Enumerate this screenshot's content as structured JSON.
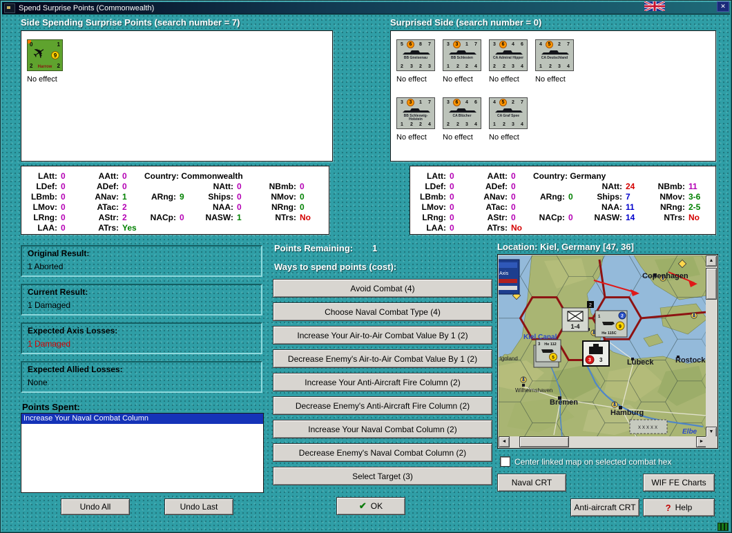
{
  "window": {
    "title": "Spend Surprise Points (Commonwealth)"
  },
  "icons": {
    "close": "✕",
    "check": "✔",
    "help": "?",
    "up": "▲",
    "down": "▼",
    "left": "◄",
    "right": "►",
    "plane": "✈"
  },
  "headers": {
    "spending": "Side Spending Surprise Points (search number = 7)",
    "surprised": "Surprised Side (search number = 0)",
    "points_remaining_label": "Points Remaining:",
    "points_remaining_value": "1",
    "ways": "Ways to spend points (cost):",
    "location": "Location: Kiel, Germany [47, 36]",
    "center_map": "Center linked map on selected combat hex",
    "points_spent": "Points Spent:"
  },
  "spending_unit": {
    "tl": "0",
    "tr": "1",
    "rating": "9",
    "bl": "2",
    "name": "Harrow",
    "br": "2",
    "effect": "No effect"
  },
  "surprised": {
    "row1": [
      {
        "t1": "5",
        "t2": "6",
        "t3": "8",
        "t4": "7",
        "name": "BB Gneisenau",
        "b1": "2",
        "b2": "3",
        "b3": "2",
        "b4": "3",
        "effect": "No effect"
      },
      {
        "t1": "3",
        "t2": "3",
        "t3": "1",
        "t4": "7",
        "name": "BB Schlesien",
        "b1": "1",
        "b2": "2",
        "b3": "2",
        "b4": "4",
        "effect": "No effect"
      },
      {
        "t1": "3",
        "t2": "6",
        "t3": "4",
        "t4": "6",
        "name": "CA Admiral Hipper",
        "b1": "2",
        "b2": "2",
        "b3": "3",
        "b4": "4",
        "effect": "No effect"
      },
      {
        "t1": "4",
        "t2": "5",
        "t3": "2",
        "t4": "7",
        "name": "CA Deutschland",
        "b1": "1",
        "b2": "2",
        "b3": "3",
        "b4": "4",
        "effect": "No effect"
      }
    ],
    "row2": [
      {
        "t1": "3",
        "t2": "3",
        "t3": "1",
        "t4": "7",
        "name": "BB Schleswig-Holstein",
        "b1": "1",
        "b2": "2",
        "b3": "2",
        "b4": "4",
        "effect": "No effect"
      },
      {
        "t1": "3",
        "t2": "6",
        "t3": "4",
        "t4": "6",
        "name": "CA Blücher",
        "b1": "2",
        "b2": "2",
        "b3": "3",
        "b4": "4",
        "effect": "No effect"
      },
      {
        "t1": "4",
        "t2": "5",
        "t3": "2",
        "t4": "7",
        "name": "CA Graf Spee",
        "b1": "1",
        "b2": "2",
        "b3": "3",
        "b4": "4",
        "effect": "No effect"
      }
    ]
  },
  "stats": {
    "commonwealth": {
      "country": "Country: Commonwealth",
      "col1": [
        {
          "l": "LAtt:",
          "v": "0",
          "c": "#b400b4"
        },
        {
          "l": "LDef:",
          "v": "0",
          "c": "#b400b4"
        },
        {
          "l": "LBmb:",
          "v": "0",
          "c": "#b400b4"
        },
        {
          "l": "LMov:",
          "v": "0",
          "c": "#b400b4"
        },
        {
          "l": "LRng:",
          "v": "0",
          "c": "#b400b4"
        },
        {
          "l": "LAA:",
          "v": "0",
          "c": "#b400b4"
        }
      ],
      "col2": [
        {
          "l": "AAtt:",
          "v": "0",
          "c": "#b400b4"
        },
        {
          "l": "ADef:",
          "v": "0",
          "c": "#b400b4"
        },
        {
          "l": "ANav:",
          "v": "1",
          "c": "#008000"
        },
        {
          "l": "ATac:",
          "v": "2",
          "c": "#b400b4"
        },
        {
          "l": "AStr:",
          "v": "2",
          "c": "#b400b4"
        },
        {
          "l": "ATrs:",
          "v": "Yes",
          "c": "#008000"
        }
      ],
      "col3": [
        {
          "l": "",
          "v": "",
          "c": ""
        },
        {
          "l": "",
          "v": "",
          "c": ""
        },
        {
          "l": "ARng:",
          "v": "9",
          "c": "#008000"
        },
        {
          "l": "",
          "v": "",
          "c": ""
        },
        {
          "l": "NACp:",
          "v": "0",
          "c": "#b400b4"
        },
        {
          "l": "",
          "v": "",
          "c": ""
        }
      ],
      "col4": [
        {
          "l": "",
          "v": "",
          "c": ""
        },
        {
          "l": "NAtt:",
          "v": "0",
          "c": "#b400b4"
        },
        {
          "l": "Ships:",
          "v": "0",
          "c": "#b400b4"
        },
        {
          "l": "NAA:",
          "v": "0",
          "c": "#b400b4"
        },
        {
          "l": "NASW:",
          "v": "1",
          "c": "#008000"
        },
        {
          "l": "",
          "v": "",
          "c": ""
        }
      ],
      "col5": [
        {
          "l": "",
          "v": "",
          "c": ""
        },
        {
          "l": "NBmb:",
          "v": "0",
          "c": "#b400b4"
        },
        {
          "l": "NMov:",
          "v": "0",
          "c": "#008000"
        },
        {
          "l": "NRng:",
          "v": "0",
          "c": "#008000"
        },
        {
          "l": "NTrs:",
          "v": "No",
          "c": "#d40000"
        },
        {
          "l": "",
          "v": "",
          "c": ""
        }
      ]
    },
    "germany": {
      "country": "Country: Germany",
      "col1": [
        {
          "l": "LAtt:",
          "v": "0",
          "c": "#b400b4"
        },
        {
          "l": "LDef:",
          "v": "0",
          "c": "#b400b4"
        },
        {
          "l": "LBmb:",
          "v": "0",
          "c": "#b400b4"
        },
        {
          "l": "LMov:",
          "v": "0",
          "c": "#b400b4"
        },
        {
          "l": "LRng:",
          "v": "0",
          "c": "#b400b4"
        },
        {
          "l": "LAA:",
          "v": "0",
          "c": "#b400b4"
        }
      ],
      "col2": [
        {
          "l": "AAtt:",
          "v": "0",
          "c": "#b400b4"
        },
        {
          "l": "ADef:",
          "v": "0",
          "c": "#b400b4"
        },
        {
          "l": "ANav:",
          "v": "0",
          "c": "#b400b4"
        },
        {
          "l": "ATac:",
          "v": "0",
          "c": "#b400b4"
        },
        {
          "l": "AStr:",
          "v": "0",
          "c": "#b400b4"
        },
        {
          "l": "ATrs:",
          "v": "No",
          "c": "#d40000"
        }
      ],
      "col3": [
        {
          "l": "",
          "v": "",
          "c": ""
        },
        {
          "l": "",
          "v": "",
          "c": ""
        },
        {
          "l": "ARng:",
          "v": "0",
          "c": "#008000"
        },
        {
          "l": "",
          "v": "",
          "c": ""
        },
        {
          "l": "NACp:",
          "v": "0",
          "c": "#b400b4"
        },
        {
          "l": "",
          "v": "",
          "c": ""
        }
      ],
      "col4": [
        {
          "l": "",
          "v": "",
          "c": ""
        },
        {
          "l": "NAtt:",
          "v": "24",
          "c": "#d40000"
        },
        {
          "l": "Ships:",
          "v": "7",
          "c": "#0000cc"
        },
        {
          "l": "NAA:",
          "v": "11",
          "c": "#0000cc"
        },
        {
          "l": "NASW:",
          "v": "14",
          "c": "#0000cc"
        },
        {
          "l": "",
          "v": "",
          "c": ""
        }
      ],
      "col5": [
        {
          "l": "",
          "v": "",
          "c": ""
        },
        {
          "l": "NBmb:",
          "v": "11",
          "c": "#b400b4"
        },
        {
          "l": "NMov:",
          "v": "3-6",
          "c": "#008000"
        },
        {
          "l": "NRng:",
          "v": "2-5",
          "c": "#008000"
        },
        {
          "l": "NTrs:",
          "v": "No",
          "c": "#d40000"
        },
        {
          "l": "",
          "v": "",
          "c": ""
        }
      ]
    }
  },
  "results": [
    {
      "title": "Original Result:",
      "value": "1 Aborted",
      "color": "#000000"
    },
    {
      "title": "Current Result:",
      "value": "1 Damaged",
      "color": "#000000"
    },
    {
      "title": "Expected Axis Losses:",
      "value": "1 Damaged",
      "color": "#d40000"
    },
    {
      "title": "Expected Allied Losses:",
      "value": "None",
      "color": "#000000"
    }
  ],
  "points_spent_items": [
    {
      "text": "Increase Your Naval Combat Column"
    }
  ],
  "spend_buttons": [
    "Avoid Combat (4)",
    "Choose Naval Combat Type (4)",
    "Increase Your Air-to-Air Combat Value By 1 (2)",
    "Decrease Enemy's Air-to-Air Combat Value By 1 (2)",
    "Increase Your Anti-Aircraft Fire Column (2)",
    "Decrease Enemy's Anti-Aircraft Fire Column (2)",
    "Increase Your Naval Combat Column (2)",
    "Decrease Enemy's Naval Combat Column (2)",
    "Select Target (3)"
  ],
  "buttons": {
    "undo_all": "Undo All",
    "undo_last": "Undo Last",
    "ok": "OK",
    "naval_crt": "Naval CRT",
    "wif_charts": "WIF FE Charts",
    "aa_crt": "Anti-aircraft CRT",
    "help": "Help"
  },
  "map": {
    "labels": {
      "copenhagen": "Copenhagen",
      "kiel_canal": "Kiel Canal",
      "lubeck": "Lübeck",
      "rostock": "Rostock",
      "wilhelmshaven": "Wilhelmshaven",
      "bremen": "Bremen",
      "hamburg": "Hamburg",
      "elbe": "Elbe",
      "helgoland": "lgoland",
      "army_group": "xxxxx",
      "axis_panel": "Axis"
    },
    "counters": {
      "division_strength": "1-4",
      "stack_badge": "2",
      "he115c_name": "He 115C",
      "he115c_left": "1",
      "he115c_badge": "2",
      "he115c_rating": "9",
      "he112_name": "He 112",
      "he112_left": "3",
      "he112_rating": "5",
      "naval_loss": "3",
      "naval_value": "3"
    }
  }
}
